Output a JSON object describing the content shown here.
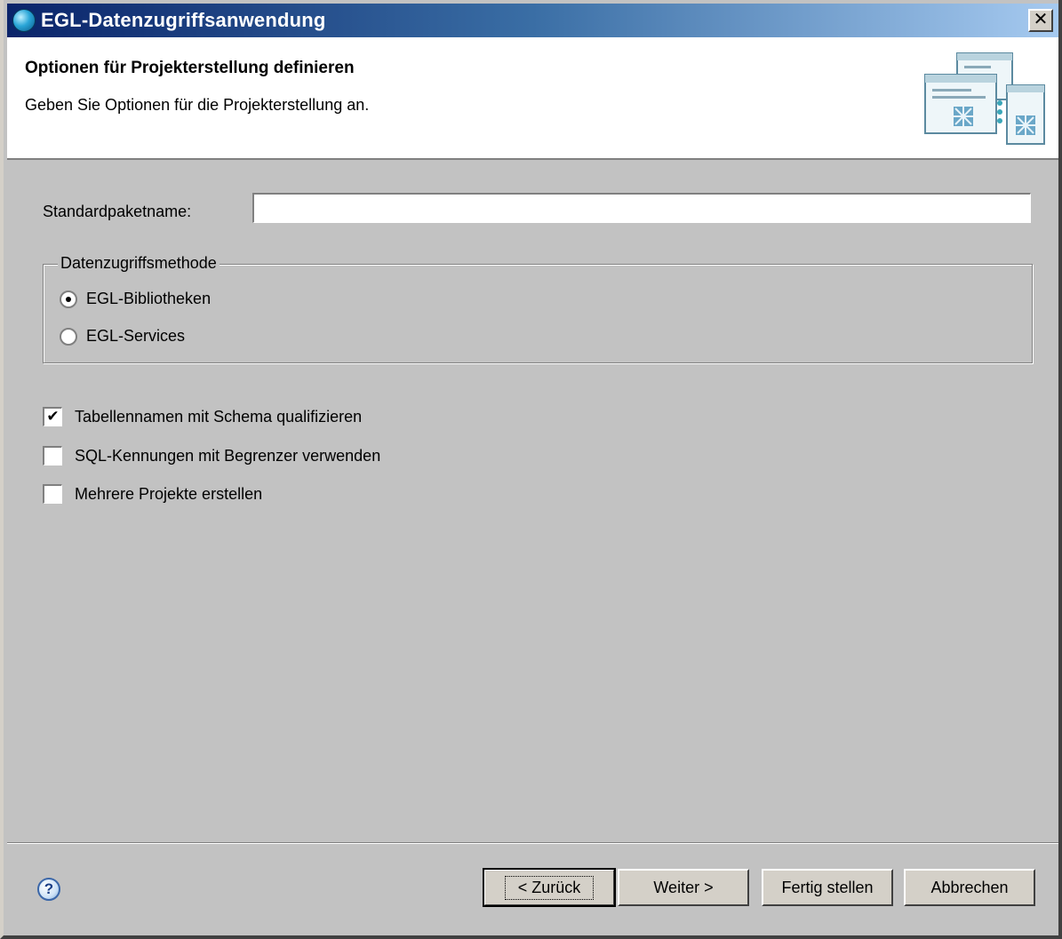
{
  "window": {
    "title": "EGL-Datenzugriffsanwendung",
    "close_label": "✕"
  },
  "banner": {
    "title": "Optionen für Projekterstellung definieren",
    "description": "Geben Sie Optionen für die Projekterstellung an."
  },
  "form": {
    "package_label": "Standardpaketname:",
    "package_value": "",
    "access_group": {
      "legend": "Datenzugriffsmethode",
      "options": [
        {
          "label": "EGL-Bibliotheken",
          "selected": true
        },
        {
          "label": "EGL-Services",
          "selected": false
        }
      ]
    },
    "checkboxes": [
      {
        "label": "Tabellennamen mit Schema qualifizieren",
        "checked": true
      },
      {
        "label": "SQL-Kennungen mit Begrenzer verwenden",
        "checked": false
      },
      {
        "label": "Mehrere Projekte erstellen",
        "checked": false
      }
    ]
  },
  "footer": {
    "help_glyph": "?",
    "back_label": "< Zurück",
    "next_label": "Weiter >",
    "finish_label": "Fertig stellen",
    "cancel_label": "Abbrechen"
  },
  "colors": {
    "title_gradient_start": "#0a246a",
    "title_gradient_end": "#a6caf0",
    "dialog_bg": "#c2c2c2",
    "button_face": "#d4d0c8"
  },
  "icons": {
    "app": "egl-globe-icon",
    "banner": "wizard-windows-icon",
    "help": "help-icon"
  }
}
